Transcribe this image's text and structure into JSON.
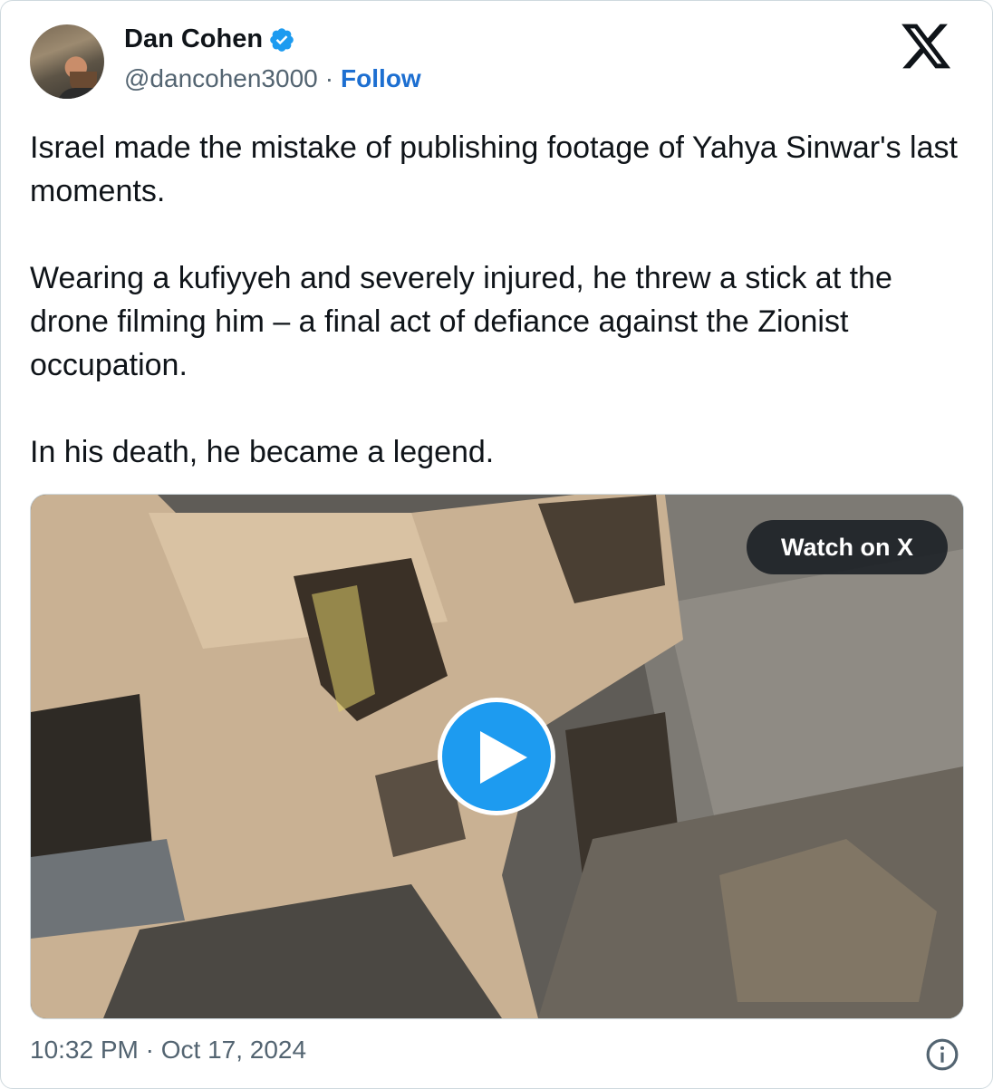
{
  "author": {
    "name": "Dan Cohen",
    "handle": "@dancohen3000",
    "separator": "·",
    "follow_label": "Follow"
  },
  "icons": {
    "verified": "verified-badge-icon",
    "brand": "x-logo-icon",
    "play": "play-icon",
    "info": "info-icon"
  },
  "tweet": {
    "paragraphs": [
      "Israel made the mistake of publishing footage of Yahya Sinwar's last moments.",
      "Wearing a kufiyyeh and severely injured, he threw a stick at the drone filming him – a final act of defiance against the Zionist occupation.",
      "In his death, he became a legend."
    ]
  },
  "media": {
    "watch_label": "Watch on X"
  },
  "footer": {
    "timestamp": "10:32 PM · Oct 17, 2024"
  },
  "colors": {
    "accent": "#1d9bf0",
    "follow": "#1d6fd1",
    "text": "#0f1419",
    "secondary": "#536471"
  }
}
